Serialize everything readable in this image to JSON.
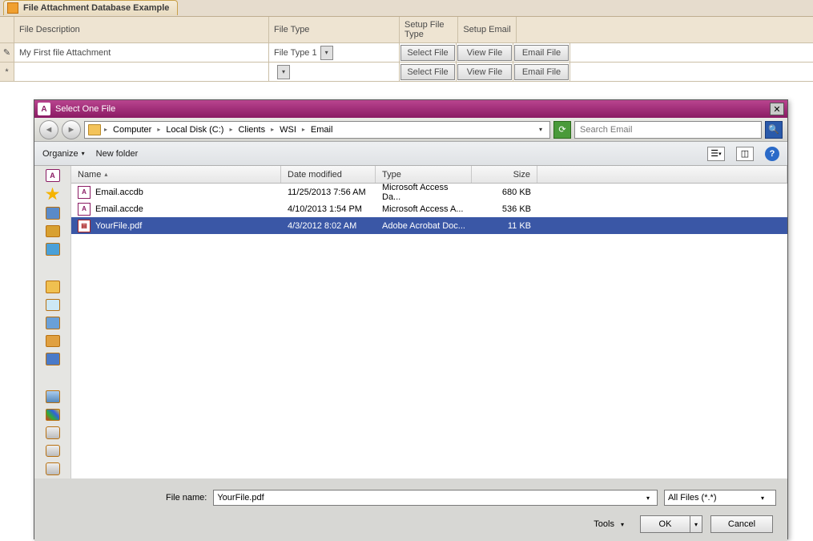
{
  "form": {
    "tab_label": "File Attachment Database Example",
    "headers": {
      "file_description": "File Description",
      "file_type": "File Type",
      "setup_file_type": "Setup File Type",
      "setup_email": "Setup Email"
    },
    "rows": [
      {
        "marker": "✎",
        "description": "My First file Attachment",
        "file_type": "File Type 1",
        "select": "Select File",
        "view": "View File",
        "email": "Email File"
      },
      {
        "marker": "*",
        "description": "",
        "file_type": "",
        "select": "Select File",
        "view": "View File",
        "email": "Email File"
      }
    ]
  },
  "dialog": {
    "title": "Select One File",
    "breadcrumb": [
      "Computer",
      "Local Disk (C:)",
      "Clients",
      "WSI",
      "Email"
    ],
    "search_placeholder": "Search Email",
    "toolbar": {
      "organize": "Organize",
      "new_folder": "New folder"
    },
    "columns": {
      "name": "Name",
      "date": "Date modified",
      "type": "Type",
      "size": "Size"
    },
    "files": [
      {
        "name": "Email.accdb",
        "date": "11/25/2013 7:56 AM",
        "type": "Microsoft Access Da...",
        "size": "680 KB",
        "icon": "access",
        "selected": false
      },
      {
        "name": "Email.accde",
        "date": "4/10/2013 1:54 PM",
        "type": "Microsoft Access A...",
        "size": "536 KB",
        "icon": "access",
        "selected": false
      },
      {
        "name": "YourFile.pdf",
        "date": "4/3/2012 8:02 AM",
        "type": "Adobe Acrobat Doc...",
        "size": "11 KB",
        "icon": "pdf",
        "selected": true
      }
    ],
    "footer": {
      "file_name_label": "File name:",
      "file_name_value": "YourFile.pdf",
      "filter": "All Files (*.*)",
      "tools": "Tools",
      "ok": "OK",
      "cancel": "Cancel"
    }
  }
}
